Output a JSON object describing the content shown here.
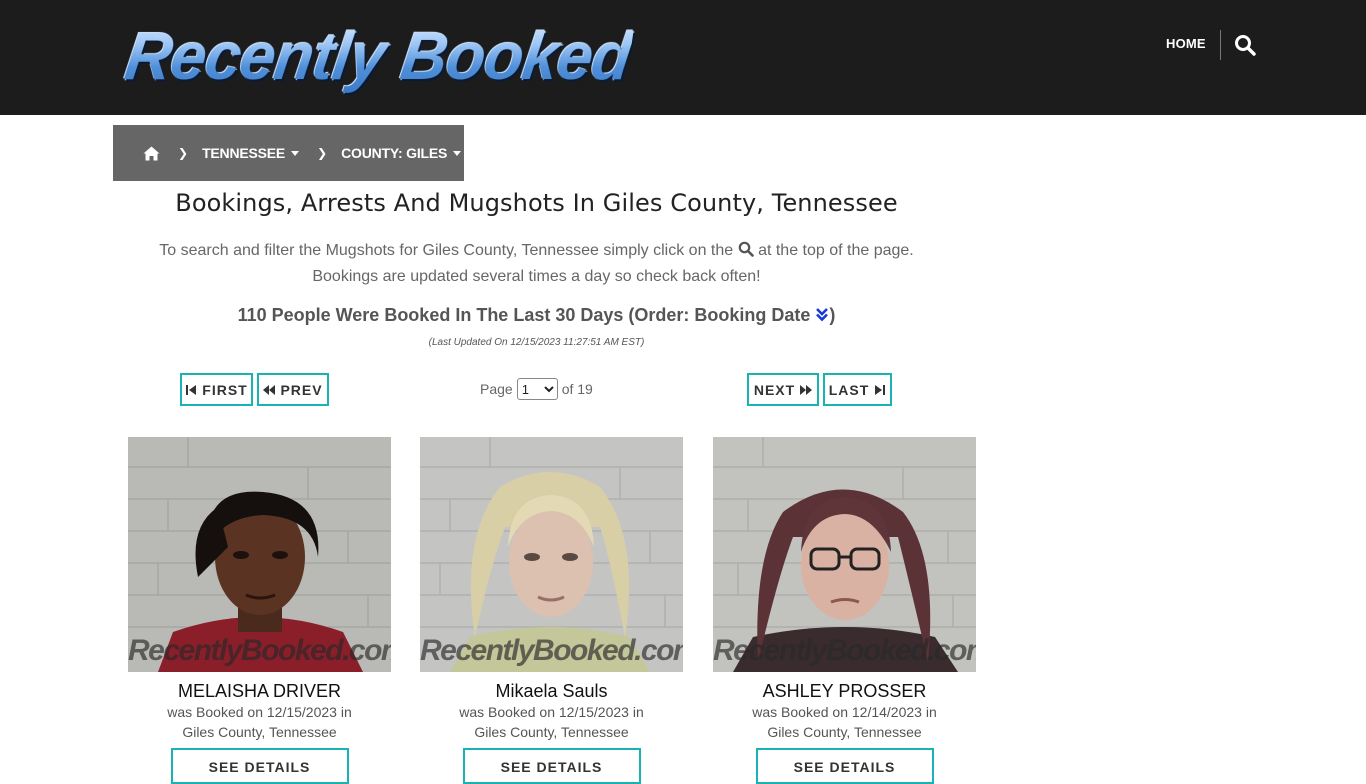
{
  "header": {
    "logo_text": "Recently Booked",
    "nav_home": "HOME",
    "search_icon": "search-icon"
  },
  "breadcrumb": {
    "home_icon": "home-icon",
    "items": [
      {
        "label": "TENNESSEE"
      },
      {
        "label": "COUNTY: GILES"
      }
    ]
  },
  "main": {
    "title": "Bookings, Arrests And Mugshots In Giles County, Tennessee",
    "intro_before_icon": "To search and filter the Mugshots for Giles County, Tennessee simply click on the",
    "intro_after_icon": "at the top of the page.",
    "intro_line2": "Bookings are updated several times a day so check back often!",
    "count_text": "110 People Were Booked In The Last 30 Days (Order: Booking Date",
    "count_close": ")",
    "updated_text": "(Last Updated On 12/15/2023 11:27:51 AM EST)"
  },
  "pager": {
    "first": "FIRST",
    "prev": "PREV",
    "next": "NEXT",
    "last": "LAST",
    "page_label": "Page",
    "page_value": "1",
    "of_label": "of 19"
  },
  "watermark": "RecentlyBooked.com",
  "people": [
    {
      "name": "MELAISHA DRIVER",
      "booked_line": "was Booked on 12/15/2023 in",
      "location": "Giles County, Tennessee",
      "button": "SEE DETAILS"
    },
    {
      "name": "Mikaela Sauls",
      "booked_line": "was Booked on 12/15/2023 in",
      "location": "Giles County, Tennessee",
      "button": "SEE DETAILS"
    },
    {
      "name": "ASHLEY PROSSER",
      "booked_line": "was Booked on 12/14/2023 in",
      "location": "Giles County, Tennessee",
      "button": "SEE DETAILS"
    }
  ],
  "colors": {
    "header_bg": "#1c1c1c",
    "breadcrumb_bg": "#666666",
    "button_border": "#1ab3b3",
    "order_icon": "#1a3ad6"
  }
}
